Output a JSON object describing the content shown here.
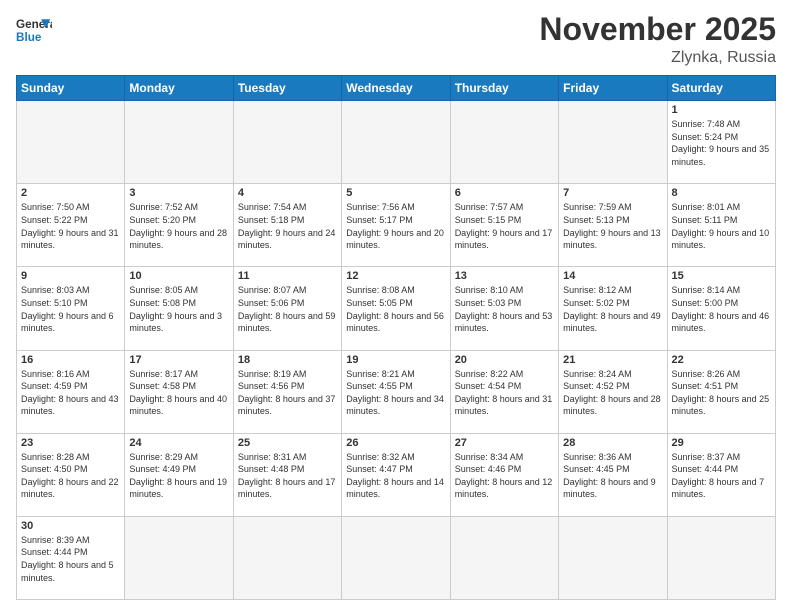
{
  "header": {
    "logo_general": "General",
    "logo_blue": "Blue",
    "month_title": "November 2025",
    "location": "Zlynka, Russia"
  },
  "weekdays": [
    "Sunday",
    "Monday",
    "Tuesday",
    "Wednesday",
    "Thursday",
    "Friday",
    "Saturday"
  ],
  "days": {
    "1": {
      "sunrise": "7:48 AM",
      "sunset": "5:24 PM",
      "daylight": "9 hours and 35 minutes."
    },
    "2": {
      "sunrise": "7:50 AM",
      "sunset": "5:22 PM",
      "daylight": "9 hours and 31 minutes."
    },
    "3": {
      "sunrise": "7:52 AM",
      "sunset": "5:20 PM",
      "daylight": "9 hours and 28 minutes."
    },
    "4": {
      "sunrise": "7:54 AM",
      "sunset": "5:18 PM",
      "daylight": "9 hours and 24 minutes."
    },
    "5": {
      "sunrise": "7:56 AM",
      "sunset": "5:17 PM",
      "daylight": "9 hours and 20 minutes."
    },
    "6": {
      "sunrise": "7:57 AM",
      "sunset": "5:15 PM",
      "daylight": "9 hours and 17 minutes."
    },
    "7": {
      "sunrise": "7:59 AM",
      "sunset": "5:13 PM",
      "daylight": "9 hours and 13 minutes."
    },
    "8": {
      "sunrise": "8:01 AM",
      "sunset": "5:11 PM",
      "daylight": "9 hours and 10 minutes."
    },
    "9": {
      "sunrise": "8:03 AM",
      "sunset": "5:10 PM",
      "daylight": "9 hours and 6 minutes."
    },
    "10": {
      "sunrise": "8:05 AM",
      "sunset": "5:08 PM",
      "daylight": "9 hours and 3 minutes."
    },
    "11": {
      "sunrise": "8:07 AM",
      "sunset": "5:06 PM",
      "daylight": "8 hours and 59 minutes."
    },
    "12": {
      "sunrise": "8:08 AM",
      "sunset": "5:05 PM",
      "daylight": "8 hours and 56 minutes."
    },
    "13": {
      "sunrise": "8:10 AM",
      "sunset": "5:03 PM",
      "daylight": "8 hours and 53 minutes."
    },
    "14": {
      "sunrise": "8:12 AM",
      "sunset": "5:02 PM",
      "daylight": "8 hours and 49 minutes."
    },
    "15": {
      "sunrise": "8:14 AM",
      "sunset": "5:00 PM",
      "daylight": "8 hours and 46 minutes."
    },
    "16": {
      "sunrise": "8:16 AM",
      "sunset": "4:59 PM",
      "daylight": "8 hours and 43 minutes."
    },
    "17": {
      "sunrise": "8:17 AM",
      "sunset": "4:58 PM",
      "daylight": "8 hours and 40 minutes."
    },
    "18": {
      "sunrise": "8:19 AM",
      "sunset": "4:56 PM",
      "daylight": "8 hours and 37 minutes."
    },
    "19": {
      "sunrise": "8:21 AM",
      "sunset": "4:55 PM",
      "daylight": "8 hours and 34 minutes."
    },
    "20": {
      "sunrise": "8:22 AM",
      "sunset": "4:54 PM",
      "daylight": "8 hours and 31 minutes."
    },
    "21": {
      "sunrise": "8:24 AM",
      "sunset": "4:52 PM",
      "daylight": "8 hours and 28 minutes."
    },
    "22": {
      "sunrise": "8:26 AM",
      "sunset": "4:51 PM",
      "daylight": "8 hours and 25 minutes."
    },
    "23": {
      "sunrise": "8:28 AM",
      "sunset": "4:50 PM",
      "daylight": "8 hours and 22 minutes."
    },
    "24": {
      "sunrise": "8:29 AM",
      "sunset": "4:49 PM",
      "daylight": "8 hours and 19 minutes."
    },
    "25": {
      "sunrise": "8:31 AM",
      "sunset": "4:48 PM",
      "daylight": "8 hours and 17 minutes."
    },
    "26": {
      "sunrise": "8:32 AM",
      "sunset": "4:47 PM",
      "daylight": "8 hours and 14 minutes."
    },
    "27": {
      "sunrise": "8:34 AM",
      "sunset": "4:46 PM",
      "daylight": "8 hours and 12 minutes."
    },
    "28": {
      "sunrise": "8:36 AM",
      "sunset": "4:45 PM",
      "daylight": "8 hours and 9 minutes."
    },
    "29": {
      "sunrise": "8:37 AM",
      "sunset": "4:44 PM",
      "daylight": "8 hours and 7 minutes."
    },
    "30": {
      "sunrise": "8:39 AM",
      "sunset": "4:44 PM",
      "daylight": "8 hours and 5 minutes."
    }
  }
}
